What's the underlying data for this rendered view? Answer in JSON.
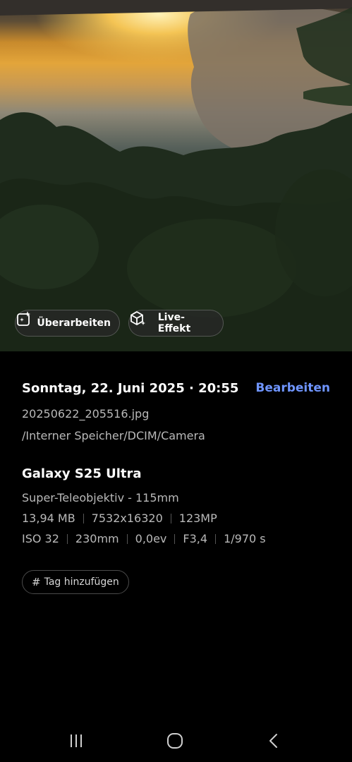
{
  "photo": {
    "actions": {
      "revise_label": "Überarbeiten",
      "live_effect_label": "Live-Effekt"
    }
  },
  "details": {
    "date": "Sonntag, 22. Juni 2025 · 20:55",
    "edit_label": "Bearbeiten",
    "filename": "20250622_205516.jpg",
    "path": "/Interner Speicher/DCIM/Camera",
    "device": "Galaxy S25 Ultra",
    "lens": "Super-Teleobjektiv - 115mm",
    "file_info": [
      "13,94 MB",
      "7532x16320",
      "123MP"
    ],
    "exposure": [
      "ISO 32",
      "230mm",
      "0,0ev",
      "F3,4",
      "1/970 s"
    ],
    "tag_label": "Tag hinzufügen"
  },
  "nav": {
    "icons": [
      "recents-icon",
      "home-icon",
      "back-icon"
    ]
  },
  "colors": {
    "accent": "#6f95ff",
    "background": "#000000",
    "secondary_text": "#b9b9b9"
  }
}
